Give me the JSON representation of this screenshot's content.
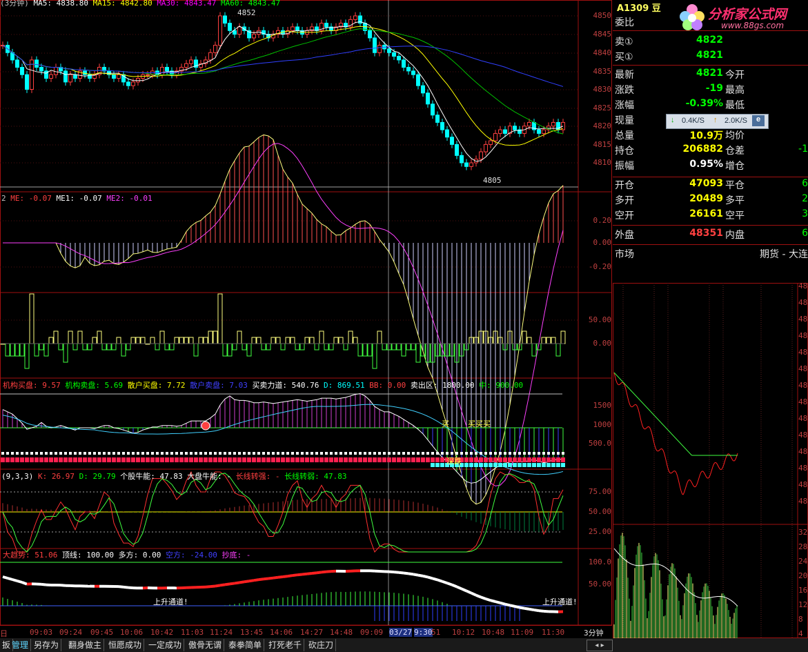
{
  "main": {
    "title_left": "(3分钟)",
    "ma": [
      {
        "label": "MA5: 4838.80",
        "color": "#ffffff"
      },
      {
        "label": "MA15: 4842.80",
        "color": "#ffff00"
      },
      {
        "label": "MA30: 4843.47",
        "color": "#ff00ff"
      },
      {
        "label": "MA60: 4843.47",
        "color": "#00ff00"
      }
    ],
    "high_label": "4852",
    "low_label": "4805",
    "axis": [
      "4850",
      "4845",
      "4840",
      "4835",
      "4830",
      "4825",
      "4820",
      "4815",
      "4810"
    ]
  },
  "macd": {
    "prefix": "2",
    "items": [
      {
        "label": "ME: -0.07",
        "color": "#ff4040"
      },
      {
        "label": "ME1: -0.07",
        "color": "#ffffff"
      },
      {
        "label": "ME2: -0.01",
        "color": "#ff40ff"
      }
    ],
    "axis": [
      "0.20",
      "0.00",
      "-0.20"
    ]
  },
  "vol": {
    "axis": [
      "50.00",
      "0.00"
    ]
  },
  "flow": {
    "items": [
      {
        "label": "机构买盘: 9.57",
        "color": "#ff4040"
      },
      {
        "label": "机构卖盘: 5.69",
        "color": "#00ff00"
      },
      {
        "label": "散户买盘: 7.72",
        "color": "#ffff00"
      },
      {
        "label": "散户卖盘: 7.03",
        "color": "#4040ff"
      },
      {
        "label": "买卖力道: 540.76",
        "color": "#ffffff"
      },
      {
        "label": "D: 869.51",
        "color": "#00ffff"
      },
      {
        "label": "BB: 0.00",
        "color": "#ff4040"
      },
      {
        "label": "卖出区: 1800.00",
        "color": "#ffffff"
      },
      {
        "label": "中: 900.00",
        "color": "#00ff00"
      }
    ],
    "axis": [
      "1500",
      "1000",
      "500.0"
    ],
    "tag_buy1": "买",
    "tag_buy2": "买买买",
    "tag_low": "深跌"
  },
  "kd": {
    "items": [
      {
        "label": "(9,3,3)",
        "color": "#ffffff"
      },
      {
        "label": "K: 26.97",
        "color": "#ff4040"
      },
      {
        "label": "D: 29.79",
        "color": "#00ff00"
      },
      {
        "label": "个股牛能: 47.83",
        "color": "#ffffff"
      },
      {
        "label": "大盘牛能: -",
        "color": "#ffffff"
      },
      {
        "label": "长线转强: -",
        "color": "#ff4040"
      },
      {
        "label": "长线转弱: 47.83",
        "color": "#00ff00"
      }
    ],
    "axis": [
      "75.00",
      "50.00",
      "25.00"
    ]
  },
  "trend": {
    "items": [
      {
        "label": "大趋势: 51.06",
        "color": "#ff4040"
      },
      {
        "label": "顶线: 100.00",
        "color": "#ffffff"
      },
      {
        "label": "多方: 0.00",
        "color": "#ffffff"
      },
      {
        "label": "空方: -24.00",
        "color": "#4040ff"
      },
      {
        "label": "抄底: -",
        "color": "#ff40ff"
      }
    ],
    "axis": [
      "100.0",
      "50.00"
    ],
    "tag1": "上升通道!",
    "tag2": "上升通道!"
  },
  "time_axis": [
    "日",
    "09:03",
    "09:24",
    "09:45",
    "10:06",
    "10:42",
    "11:03",
    "11:24",
    "13:45",
    "14:06",
    "14:27",
    "14:48",
    "09:09",
    "03/27",
    "9:30",
    "51",
    "10:12",
    "10:48",
    "11:09",
    "11:30"
  ],
  "period": "3分钟",
  "quote": {
    "symbol": "A1309 豆",
    "logo_text": "分析家公式网",
    "logo_url": "www.88gs.com",
    "weibi": "委比",
    "rows": [
      {
        "l": "卖①",
        "v": "4822",
        "vc": "#00ff00"
      },
      {
        "l": "买①",
        "v": "4821",
        "vc": "#00ff00"
      }
    ],
    "rows2": [
      {
        "l": "最新",
        "v": "4821",
        "vc": "#00ff00",
        "l2": "今开",
        "v2": ""
      },
      {
        "l": "涨跌",
        "v": "-19",
        "vc": "#00ff00",
        "l2": "最高",
        "v2": ""
      },
      {
        "l": "涨幅",
        "v": "-0.39%",
        "vc": "#00ff00",
        "l2": "最低",
        "v2": ""
      },
      {
        "l": "现量",
        "v": "",
        "vc": "#ffff00",
        "l2": "结",
        "v2": ""
      },
      {
        "l": "总量",
        "v": "10.9万",
        "vc": "#ffff00",
        "l2": "均价",
        "v2": ""
      },
      {
        "l": "持仓",
        "v": "206882",
        "vc": "#ffff00",
        "l2": "仓差",
        "v2": "-1"
      },
      {
        "l": "振幅",
        "v": "0.95%",
        "vc": "#ffffff",
        "l2": "增仓",
        "v2": ""
      }
    ],
    "rows3": [
      {
        "l": "开仓",
        "v": "47093",
        "vc": "#ffff00",
        "l2": "平仓",
        "v2": "6"
      },
      {
        "l": "多开",
        "v": "20489",
        "vc": "#ffff00",
        "l2": "多平",
        "v2": "2"
      },
      {
        "l": "空开",
        "v": "26161",
        "vc": "#ffff00",
        "l2": "空平",
        "v2": "3"
      }
    ],
    "outer": {
      "l": "外盘",
      "v": "48351",
      "vc": "#ff4040",
      "l2": "内盘",
      "v2": "6"
    },
    "market": {
      "l": "市场",
      "v": "期货 - 大连"
    },
    "widget": {
      "speed": "0.4K/S",
      "down": "2.0K/S"
    }
  },
  "mini_axis": [
    "48",
    "48",
    "48",
    "48",
    "48",
    "48",
    "48",
    "48",
    "48",
    "48",
    "48",
    "48",
    "48",
    "48"
  ],
  "mini_vol_axis": [
    "32",
    "28",
    "24",
    "20",
    "16",
    "12",
    "8",
    "4"
  ],
  "tabs": [
    "扳",
    "管理",
    "另存为",
    "翻身做主",
    "恒愿成功",
    "一定成功",
    "傲骨无谓",
    "泰拳简单",
    "打死老千",
    "砍庄刀"
  ]
}
